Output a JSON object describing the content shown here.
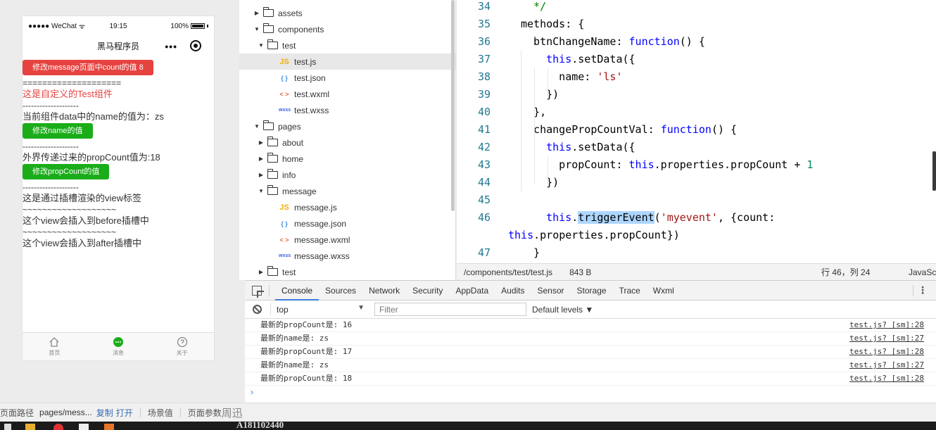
{
  "simulator": {
    "status": {
      "carrier": "●●●●● WeChat",
      "wifi": "ᯤ",
      "time": "19:15",
      "battery": "100%"
    },
    "nav_title": "黑马程序员",
    "nav_more": "•••",
    "page": {
      "btn_change_count": "修改message页面中count的值 8",
      "sep_equals": "====================",
      "component_title": "这是自定义的Test组件",
      "sep_dash": "--------------------",
      "name_label": "当前组件data中的name的值为：zs",
      "btn_change_name": "修改name的值",
      "prop_label": "外界传递过来的propCount值为:18",
      "btn_change_prop": "修改propCount的值",
      "slot_text": "这是通过插槽渲染的view标签",
      "sep_tilde": "~~~~~~~~~~~~~~~~~~~",
      "before_text": "这个view会插入到before插槽中",
      "after_text": "这个view会插入到after插槽中"
    },
    "tabs": [
      {
        "label": "首页",
        "icon": "home-icon"
      },
      {
        "label": "消息",
        "icon": "message-icon"
      },
      {
        "label": "关于",
        "icon": "about-icon"
      }
    ]
  },
  "file_tree": [
    {
      "label": "assets",
      "kind": "folder",
      "level": 0,
      "open": false
    },
    {
      "label": "components",
      "kind": "folder",
      "level": 0,
      "open": true
    },
    {
      "label": "test",
      "kind": "folder",
      "level": 1,
      "open": true
    },
    {
      "label": "test.js",
      "kind": "js",
      "level": 2,
      "active": true
    },
    {
      "label": "test.json",
      "kind": "json",
      "level": 2
    },
    {
      "label": "test.wxml",
      "kind": "wxml",
      "level": 2
    },
    {
      "label": "test.wxss",
      "kind": "wxss",
      "level": 2
    },
    {
      "label": "pages",
      "kind": "folder",
      "level": 0,
      "open": true
    },
    {
      "label": "about",
      "kind": "folder",
      "level": 1,
      "open": false
    },
    {
      "label": "home",
      "kind": "folder",
      "level": 1,
      "open": false
    },
    {
      "label": "info",
      "kind": "folder",
      "level": 1,
      "open": false
    },
    {
      "label": "message",
      "kind": "folder",
      "level": 1,
      "open": true
    },
    {
      "label": "message.js",
      "kind": "js",
      "level": 2
    },
    {
      "label": "message.json",
      "kind": "json",
      "level": 2
    },
    {
      "label": "message.wxml",
      "kind": "wxml",
      "level": 2
    },
    {
      "label": "message.wxss",
      "kind": "wxss",
      "level": 2
    },
    {
      "label": "test",
      "kind": "folder",
      "level": 1,
      "open": false
    }
  ],
  "badges": {
    "js": "JS",
    "json": "{ }",
    "wxml": "< >",
    "wxss": "wxss"
  },
  "editor": {
    "lines": [
      {
        "n": "34",
        "segs": [
          [
            "com",
            "  */"
          ]
        ]
      },
      {
        "n": "35",
        "segs": [
          [
            "",
            "methods: {"
          ]
        ]
      },
      {
        "n": "36",
        "segs": [
          [
            "",
            "  btnChangeName: "
          ],
          [
            "kw",
            "function"
          ],
          [
            "",
            "() {"
          ]
        ]
      },
      {
        "n": "37",
        "segs": [
          [
            "",
            "    "
          ],
          [
            "kw",
            "this"
          ],
          [
            "",
            ".setData({"
          ]
        ]
      },
      {
        "n": "38",
        "segs": [
          [
            "",
            "      name: "
          ],
          [
            "str",
            "'ls'"
          ]
        ]
      },
      {
        "n": "39",
        "segs": [
          [
            "",
            "    })"
          ]
        ]
      },
      {
        "n": "40",
        "segs": [
          [
            "",
            "  },"
          ]
        ]
      },
      {
        "n": "41",
        "segs": [
          [
            "",
            "  changePropCountVal: "
          ],
          [
            "kw",
            "function"
          ],
          [
            "",
            "() {"
          ]
        ]
      },
      {
        "n": "42",
        "segs": [
          [
            "",
            "    "
          ],
          [
            "kw",
            "this"
          ],
          [
            "",
            ".setData({"
          ]
        ]
      },
      {
        "n": "43",
        "segs": [
          [
            "",
            "      propCount: "
          ],
          [
            "kw",
            "this"
          ],
          [
            "",
            ".properties.propCount + "
          ],
          [
            "num",
            "1"
          ]
        ]
      },
      {
        "n": "44",
        "segs": [
          [
            "",
            "    })"
          ]
        ]
      },
      {
        "n": "45",
        "segs": []
      },
      {
        "n": "46",
        "segs": [
          [
            "",
            "    "
          ],
          [
            "kw",
            "this"
          ],
          [
            "",
            "."
          ],
          [
            "hl",
            "triggerEvent"
          ],
          [
            "",
            "("
          ],
          [
            "str",
            "'myevent'"
          ],
          [
            "",
            ", {count:"
          ]
        ]
      },
      {
        "n": "",
        "segs": [
          [
            "kw",
            "this"
          ],
          [
            "",
            ".properties.propCount})"
          ]
        ],
        "wrap": true
      },
      {
        "n": "47",
        "segs": [
          [
            "",
            "  }"
          ]
        ]
      }
    ]
  },
  "editor_status": {
    "path": "/components/test/test.js",
    "size": "843 B",
    "position": "行 46，列 24",
    "language": "JavaSc"
  },
  "devtools": {
    "tabs": [
      "Console",
      "Sources",
      "Network",
      "Security",
      "AppData",
      "Audits",
      "Sensor",
      "Storage",
      "Trace",
      "Wxml"
    ],
    "active_tab": "Console",
    "context": "top",
    "filter_placeholder": "Filter",
    "levels": "Default levels ▼",
    "logs": [
      {
        "text": "最新的propCount是: 16",
        "src": "test.js? [sm]:28"
      },
      {
        "text": "最新的name是: zs",
        "src": "test.js? [sm]:27"
      },
      {
        "text": "最新的propCount是: 17",
        "src": "test.js? [sm]:28"
      },
      {
        "text": "最新的name是: zs",
        "src": "test.js? [sm]:27"
      },
      {
        "text": "最新的propCount是: 18",
        "src": "test.js? [sm]:28"
      }
    ],
    "prompt": "›"
  },
  "bottom_bar": {
    "page_path_label": "页面路径",
    "page_path_value": "pages/mess...",
    "copy": "复制",
    "open": "打开",
    "scene": "场景值",
    "page_params": "页面参数",
    "overlay_name": "周迅"
  },
  "overlay_id": "A181102440"
}
